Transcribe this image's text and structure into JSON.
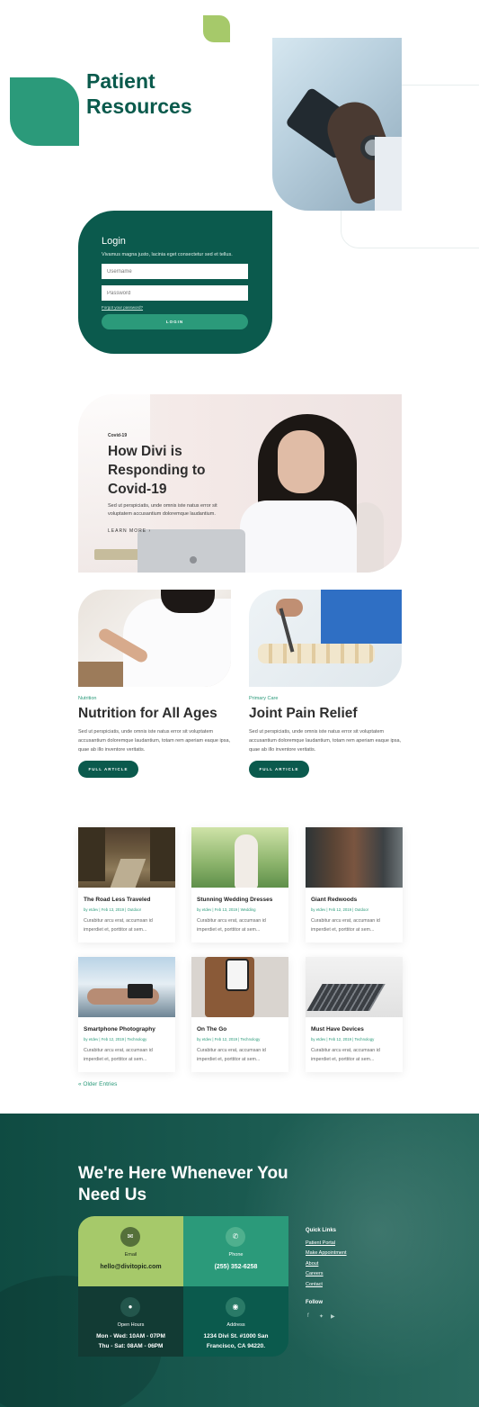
{
  "hero": {
    "title": "Patient Resources"
  },
  "login": {
    "title": "Login",
    "subtitle": "Vivamus magna justo, lacinia eget consectetur sed et tellus.",
    "username_placeholder": "Username",
    "password_placeholder": "Password",
    "forgot_link": "Forgot your password?",
    "button_label": "LOGIN"
  },
  "feature": {
    "tag": "Covid-19",
    "title": "How Divi is Responding to Covid-19",
    "description": "Sed ut perspiciatis, unde omnis iste natus error sit voluptatem accusantium doloremque laudantium.",
    "link_label": "LEARN MORE  ›"
  },
  "articles": [
    {
      "category": "Nutrition",
      "title": "Nutrition for All Ages",
      "description": "Sed ut perspiciatis, unde omnis iste natus error sit voluptatem accusantium doloremque laudantium, totam rem aperiam eaque ipsa, quae ab illo inventore veritatis.",
      "button_label": "FULL ARTICLE"
    },
    {
      "category": "Primary Care",
      "title": "Joint Pain Relief",
      "description": "Sed ut perspiciatis, unde omnis iste natus error sit voluptatem accusantium doloremque laudantium, totam rem aperiam eaque ipsa, quae ab illo inventore veritatis.",
      "button_label": "FULL ARTICLE"
    }
  ],
  "blog": {
    "posts": [
      {
        "title": "The Road Less Traveled",
        "meta": "by etdev | Feb 13, 2019 | Outdoor",
        "excerpt": "Curabitur arcu erat, accumsan id imperdiet et, porttitor at sem..."
      },
      {
        "title": "Stunning Wedding Dresses",
        "meta": "by etdev | Feb 13, 2019 | Wedding",
        "excerpt": "Curabitur arcu erat, accumsan id imperdiet et, porttitor at sem..."
      },
      {
        "title": "Giant Redwoods",
        "meta": "by etdev | Feb 12, 2019 | Outdoor",
        "excerpt": "Curabitur arcu erat, accumsan id imperdiet et, porttitor at sem..."
      },
      {
        "title": "Smartphone Photography",
        "meta": "by etdev | Feb 12, 2019 | Technology",
        "excerpt": "Curabitur arcu erat, accumsan id imperdiet et, porttitor at sem..."
      },
      {
        "title": "On The Go",
        "meta": "by etdev | Feb 12, 2019 | Technology",
        "excerpt": "Curabitur arcu erat, accumsan id imperdiet et, porttitor at sem..."
      },
      {
        "title": "Must Have Devices",
        "meta": "by etdev | Feb 12, 2019 | Technology",
        "excerpt": "Curabitur arcu erat, accumsan id imperdiet et, porttitor at sem..."
      }
    ],
    "older_entries": "« Older Entries"
  },
  "footer": {
    "title": "We're Here Whenever You Need Us",
    "contacts": {
      "email_label": "Email",
      "email_value": "hello@divitopic.com",
      "phone_label": "Phone",
      "phone_value": "(255) 352-6258",
      "hours_label": "Open Hours",
      "hours_line1": "Mon - Wed: 10AM - 07PM",
      "hours_line2": "Thu - Sat: 08AM - 06PM",
      "address_label": "Address",
      "address_line1": "1234 Divi St. #1000 San",
      "address_line2": "Francisco, CA 94220."
    },
    "quick_links_title": "Quick Links",
    "quick_links": [
      "Patient Portal",
      "Make Appointment",
      "About",
      "Careers",
      "Contact"
    ],
    "follow_title": "Follow",
    "social_icons": [
      "facebook-icon",
      "twitter-icon",
      "youtube-icon"
    ]
  },
  "colors": {
    "dark_green": "#0b5a4d",
    "teal": "#2b9a7a",
    "lime": "#a6c96a"
  }
}
